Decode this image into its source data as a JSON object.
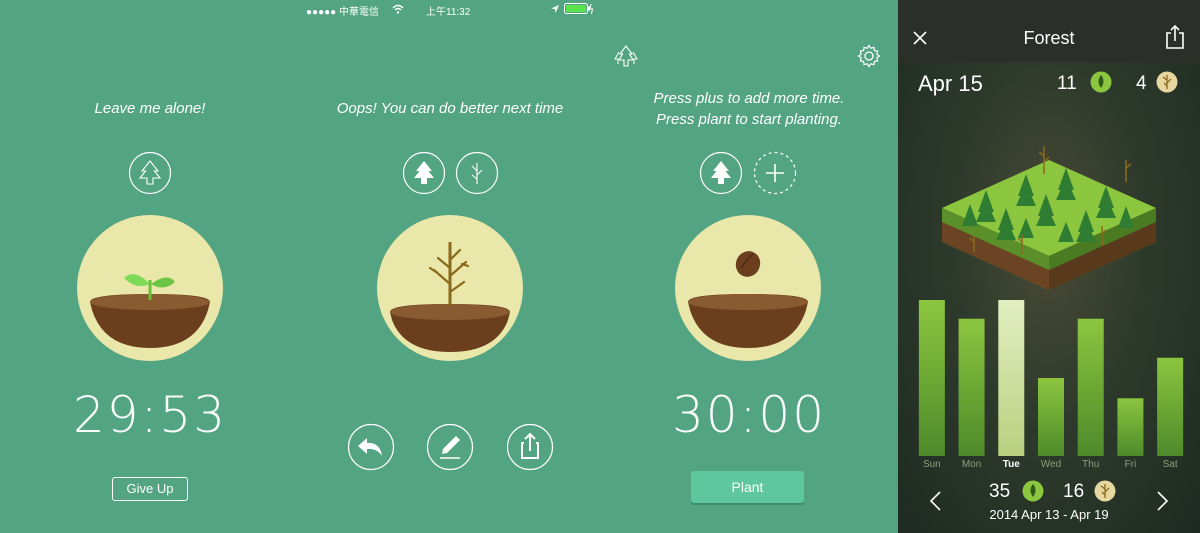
{
  "status_bar": {
    "carrier": "●●●●● 中華電信",
    "time": "上午11:32"
  },
  "screen1": {
    "message": "Leave me alone!",
    "timer": "29:53",
    "give_up_label": "Give Up"
  },
  "screen2": {
    "message": "Oops! You can do better next time"
  },
  "screen3": {
    "message_line1": "Press plus to add more time.",
    "message_line2": "Press plant to start planting.",
    "timer": "30:00",
    "plant_label": "Plant"
  },
  "forest": {
    "title": "Forest",
    "date": "Apr 15",
    "healthy_count": "11",
    "dead_count": "4",
    "week_healthy": "35",
    "week_dead": "16",
    "week_range": "2014 Apr 13 - Apr 19",
    "selected_day": "Tue"
  },
  "chart_data": {
    "type": "bar",
    "categories": [
      "Sun",
      "Mon",
      "Tue",
      "Wed",
      "Thu",
      "Fri",
      "Sat"
    ],
    "values": [
      1.0,
      0.88,
      1.0,
      0.5,
      0.88,
      0.37,
      0.63
    ],
    "ylim": [
      0,
      1
    ],
    "grid": false,
    "colors": {
      "bar_top": "#8cc63f",
      "bar_bottom": "#4e8a2a",
      "selected_top": "#e3eec1",
      "selected_bottom": "#b9d07f"
    }
  },
  "colors": {
    "background": "#53a483",
    "pot_bg": "#e9e7a9",
    "soil": "#6b3f1e",
    "plant_button": "#5ec7a0",
    "forest_bg": "#2d3a2b"
  },
  "icons": {
    "wifi": "wifi-icon",
    "location": "location-arrow-icon",
    "battery": "battery-icon",
    "forest_tree": "forest-icon",
    "settings": "gear-icon",
    "close": "close-icon",
    "share": "share-icon"
  }
}
